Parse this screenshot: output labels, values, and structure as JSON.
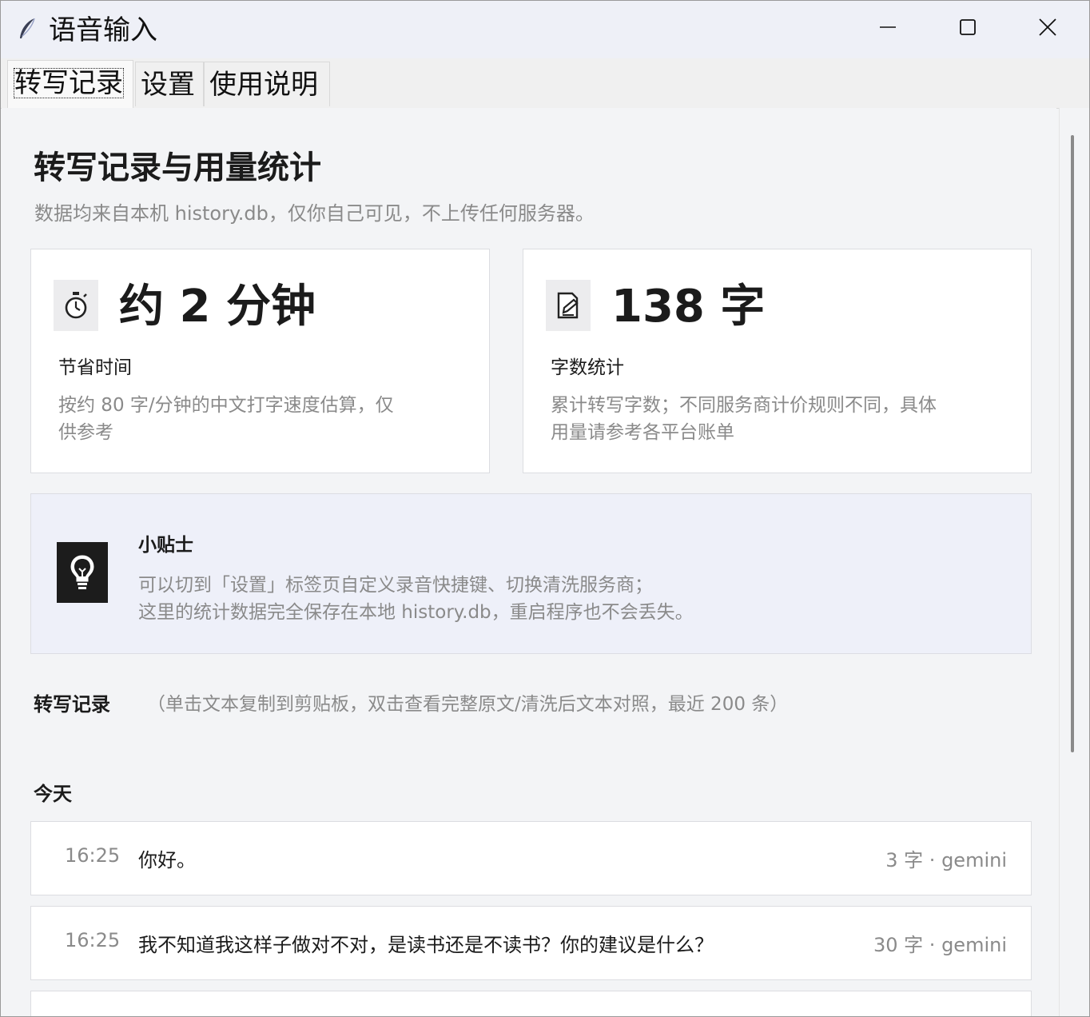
{
  "window": {
    "title": "语音输入"
  },
  "tabs": [
    {
      "label": "转写记录",
      "active": true
    },
    {
      "label": "设置",
      "active": false
    },
    {
      "label": "使用说明",
      "active": false
    }
  ],
  "page": {
    "title": "转写记录与用量统计",
    "subtitle": "数据均来自本机 history.db，仅你自己可见，不上传任何服务器。"
  },
  "stats": [
    {
      "icon": "stopwatch-icon",
      "value": "约 2 分钟",
      "label": "节省时间",
      "description": "按约 80 字/分钟的中文打字速度估算，仅供参考"
    },
    {
      "icon": "edit-document-icon",
      "value": "138 字",
      "label": "字数统计",
      "description": "累计转写字数；不同服务商计价规则不同，具体用量请参考各平台账单"
    }
  ],
  "tip": {
    "icon": "lightbulb-icon",
    "title": "小贴士",
    "lines": [
      "可以切到「设置」标签页自定义录音快捷键、切换清洗服务商；",
      "这里的统计数据完全保存在本地 history.db，重启程序也不会丢失。"
    ]
  },
  "records_section": {
    "title": "转写记录",
    "hint": "（单击文本复制到剪贴板，双击查看完整原文/清洗后文本对照，最近 200 条）",
    "group": "今天",
    "items": [
      {
        "time": "16:25",
        "text": "你好。",
        "meta": "3 字 · gemini"
      },
      {
        "time": "16:25",
        "text": "我不知道我这样子做对不对，是读书还是不读书？你的建议是什么？",
        "meta": "30 字 · gemini"
      }
    ]
  },
  "colors": {
    "background": "#f3f4f6",
    "card": "#ffffff",
    "tip_background": "#eef0f9",
    "muted_text": "#8a8a8a",
    "primary_text": "#1b1b1b"
  }
}
